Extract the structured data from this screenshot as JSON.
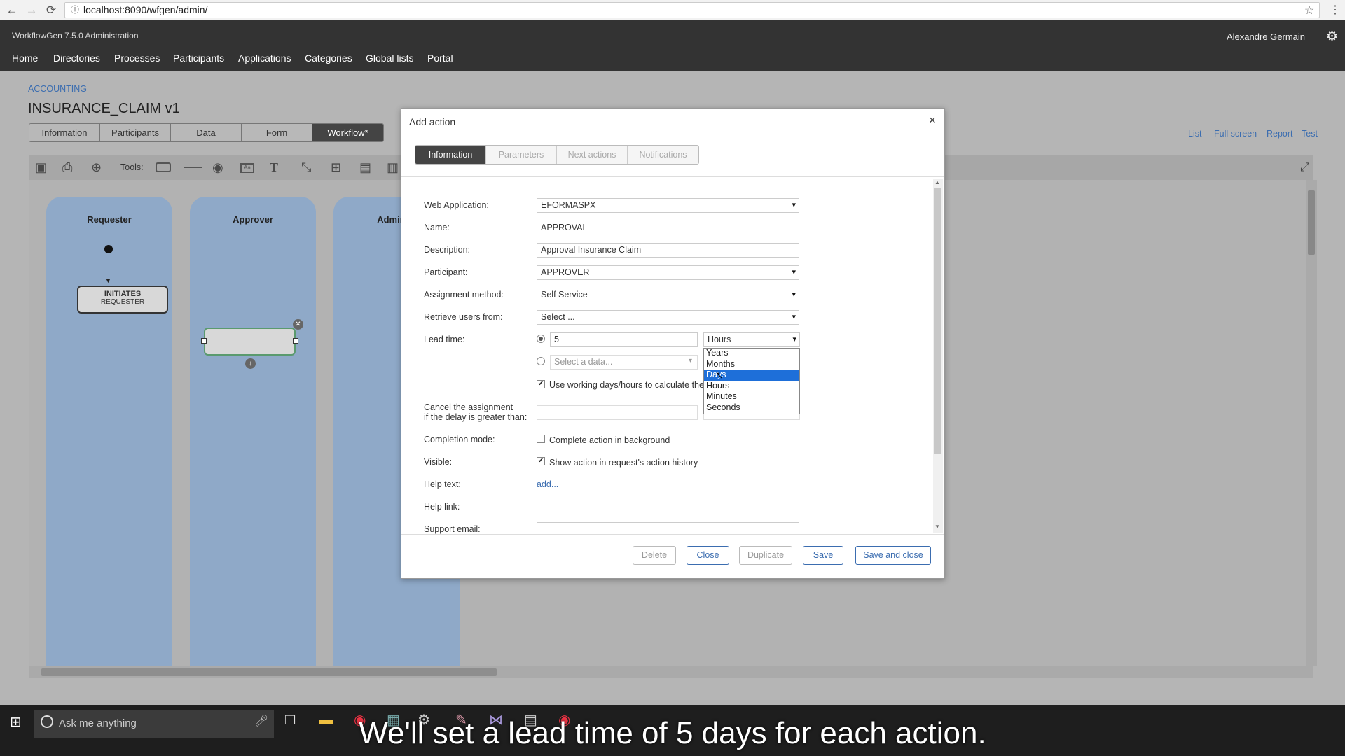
{
  "browser": {
    "url": "localhost:8090/wfgen/admin/"
  },
  "app": {
    "title": "WorkflowGen 7.5.0 Administration",
    "user": "Alexandre Germain",
    "nav": [
      "Home",
      "Directories",
      "Processes",
      "Participants",
      "Applications",
      "Categories",
      "Global lists",
      "Portal"
    ]
  },
  "page": {
    "breadcrumb": "ACCOUNTING",
    "title": "INSURANCE_CLAIM v1",
    "tabs": [
      "Information",
      "Participants",
      "Data",
      "Form",
      "Workflow*"
    ],
    "right_links": [
      "List",
      "Full screen",
      "Report",
      "Test"
    ],
    "tools_label": "Tools:"
  },
  "workflow": {
    "lanes": [
      "Requester",
      "Approver",
      "Administ"
    ],
    "node_title": "INITIATES",
    "node_sub": "REQUESTER"
  },
  "modal": {
    "title": "Add action",
    "tabs": [
      "Information",
      "Parameters",
      "Next actions",
      "Notifications"
    ],
    "labels": {
      "web_app": "Web Application:",
      "name": "Name:",
      "description": "Description:",
      "participant": "Participant:",
      "assignment": "Assignment method:",
      "retrieve": "Retrieve users from:",
      "lead_time": "Lead time:",
      "cancel1": "Cancel the assignment",
      "cancel2": "if the delay is greater than:",
      "completion": "Completion mode:",
      "visible": "Visible:",
      "help_text": "Help text:",
      "help_link": "Help link:",
      "support_email": "Support email:"
    },
    "values": {
      "web_app": "EFORMASPX",
      "name": "APPROVAL",
      "description": "Approval Insurance Claim",
      "participant": "APPROVER",
      "assignment": "Self Service",
      "retrieve": "Select ...",
      "lead_time": "5",
      "lead_unit": "Hours",
      "select_data": "Select a data...",
      "working_days": "Use working days/hours to calculate the d",
      "complete_bg": "Complete action in background",
      "show_history": "Show action in request's action history",
      "help_add": "add..."
    },
    "unit_options": [
      "Years",
      "Months",
      "Days",
      "Hours",
      "Minutes",
      "Seconds"
    ],
    "unit_highlighted": "Days",
    "buttons": [
      "Delete",
      "Close",
      "Duplicate",
      "Save",
      "Save and close"
    ]
  },
  "taskbar": {
    "search_placeholder": "Ask me anything"
  },
  "caption": "We'll set a lead time of 5 days for each action."
}
